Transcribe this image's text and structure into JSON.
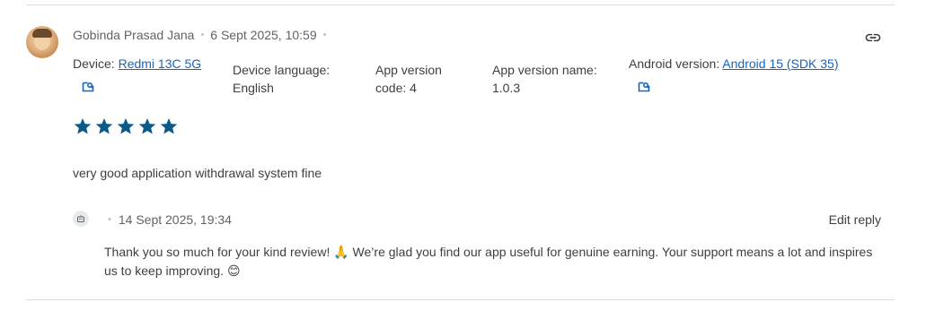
{
  "review": {
    "author": "Gobinda Prasad Jana",
    "timestamp": "6 Sept 2025, 10:59",
    "link_icon": "link-icon",
    "device": {
      "label": "Device:",
      "value": "Redmi 13C 5G"
    },
    "device_language": {
      "label": "Device language:",
      "value": "English"
    },
    "app_version_code": {
      "label": "App version code:",
      "value": "4"
    },
    "app_version_name": {
      "label": "App version name:",
      "value": "1.0.3"
    },
    "android_version": {
      "label": "Android version:",
      "value": "Android 15 (SDK 35)"
    },
    "rating": 5,
    "rating_max": 5,
    "star_color": "#0b5a8a",
    "text": "very good application withdrawal system fine"
  },
  "reply": {
    "icon": "developer-icon",
    "timestamp": "14 Sept 2025, 19:34",
    "edit_label": "Edit reply",
    "text_part1": "Thank you so much for your kind review! ",
    "emoji1": "🙏",
    "text_part2": " We’re glad you find our app useful for genuine earning. Your support means a lot and inspires us to keep improving. ",
    "emoji2": "😊"
  },
  "colors": {
    "link": "#1565c0",
    "divider": "#dadce0",
    "muted": "#5f6368"
  }
}
